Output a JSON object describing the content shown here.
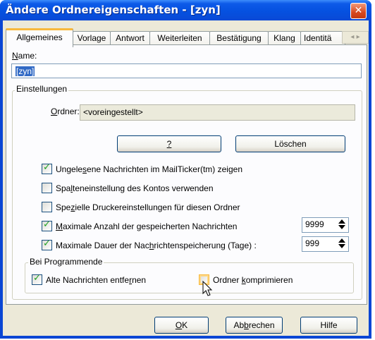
{
  "window": {
    "title": "Ändere Ordnereigenschaften - [zyn]",
    "close_glyph": "✕"
  },
  "tabs": [
    "Allgemeines",
    "Vorlage",
    "Antwort",
    "Weiterleiten",
    "Bestätigung",
    "Klang",
    "Identitä"
  ],
  "tab_scroll": "◂ ▸",
  "name": {
    "label_u": "N",
    "label_rest": "ame:",
    "value": "[zyn]"
  },
  "settings": {
    "group_label": "Einstellungen",
    "folder_label_u": "O",
    "folder_label_rest": "rdner:",
    "folder_value": "<voreingestellt>",
    "question_button": "?",
    "delete_button": "Löschen"
  },
  "options": [
    {
      "pre": "Ungele",
      "u": "s",
      "post": "ene Nachrichten im MailTicker(tm) zeigen",
      "checked": true
    },
    {
      "pre": "Spa",
      "u": "l",
      "post": "teneinstellung des Kontos verwenden",
      "checked": false
    },
    {
      "pre": "Spe",
      "u": "z",
      "post": "ielle Druckereinstellungen für diesen Ordner",
      "checked": false
    },
    {
      "pre": "",
      "u": "M",
      "post": "aximale Anzahl der gespeicherten Nachrichten",
      "checked": true,
      "spin_value": "9999"
    },
    {
      "pre": "Maximale Dauer der Nac",
      "u": "h",
      "post": "richtenspeicherung (Tage) :",
      "checked": true,
      "spin_value": "999"
    }
  ],
  "program_end": {
    "group_label": "Bei Programmende",
    "remove_old": {
      "pre": "Alte Nachrichten entfe",
      "u": "r",
      "post": "nen",
      "checked": true
    },
    "compress": {
      "pre": "Ordner ",
      "u": "k",
      "post": "omprimieren",
      "checked": false
    }
  },
  "buttons": {
    "ok_u": "O",
    "ok_rest": "K",
    "cancel_pre": "Ab",
    "cancel_u": "b",
    "cancel_post": "rechen",
    "help": "Hilfe"
  }
}
